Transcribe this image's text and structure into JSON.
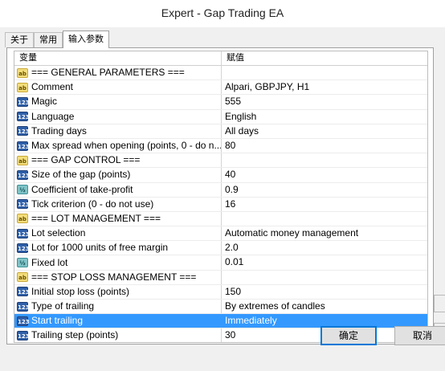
{
  "window": {
    "title": "Expert - Gap Trading EA"
  },
  "tabs": [
    {
      "label": "关于",
      "active": false
    },
    {
      "label": "常用",
      "active": false
    },
    {
      "label": "输入参数",
      "active": true
    }
  ],
  "grid": {
    "headers": {
      "variable": "变量",
      "value": "赋值"
    },
    "rows": [
      {
        "icon": "ab",
        "name": "=== GENERAL PARAMETERS ===",
        "value": "",
        "selected": false
      },
      {
        "icon": "ab",
        "name": "Comment",
        "value": "Alpari, GBPJPY, H1",
        "selected": false
      },
      {
        "icon": "num",
        "name": "Magic",
        "value": "555",
        "selected": false
      },
      {
        "icon": "num",
        "name": "Language",
        "value": "English",
        "selected": false
      },
      {
        "icon": "num",
        "name": "Trading days",
        "value": "All days",
        "selected": false
      },
      {
        "icon": "num",
        "name": "Max spread when opening (points, 0 - do n...",
        "value": "80",
        "selected": false
      },
      {
        "icon": "ab",
        "name": "=== GAP CONTROL ===",
        "value": "",
        "selected": false
      },
      {
        "icon": "num",
        "name": "Size of the gap (points)",
        "value": "40",
        "selected": false
      },
      {
        "icon": "dbl",
        "name": "Coefficient of take-profit",
        "value": "0.9",
        "selected": false
      },
      {
        "icon": "num",
        "name": "Tick criterion (0 - do not use)",
        "value": "16",
        "selected": false
      },
      {
        "icon": "ab",
        "name": "=== LOT MANAGEMENT ===",
        "value": "",
        "selected": false
      },
      {
        "icon": "num",
        "name": "Lot selection",
        "value": "Automatic money management",
        "selected": false
      },
      {
        "icon": "num",
        "name": "Lot for 1000 units of free margin",
        "value": "2.0",
        "selected": false
      },
      {
        "icon": "dbl",
        "name": "Fixed lot",
        "value": "0.01",
        "selected": false
      },
      {
        "icon": "ab",
        "name": "=== STOP LOSS MANAGEMENT ===",
        "value": "",
        "selected": false
      },
      {
        "icon": "num",
        "name": "Initial stop loss (points)",
        "value": "150",
        "selected": false
      },
      {
        "icon": "num",
        "name": "Type of trailing",
        "value": "By extremes of candles",
        "selected": false
      },
      {
        "icon": "num",
        "name": "Start trailing",
        "value": "Immediately",
        "selected": true
      },
      {
        "icon": "num",
        "name": "Trailing step (points)",
        "value": "30",
        "selected": false
      }
    ]
  },
  "icon_text": {
    "ab": "ab",
    "num": "123",
    "dbl": "½"
  },
  "icons": {
    "ab": "string-param-icon",
    "num": "integer-param-icon",
    "dbl": "double-param-icon"
  },
  "buttons": {
    "ok": "确定",
    "cancel": "取消"
  },
  "colors": {
    "selection": "#3399ff",
    "ok_border": "#0078d7"
  }
}
